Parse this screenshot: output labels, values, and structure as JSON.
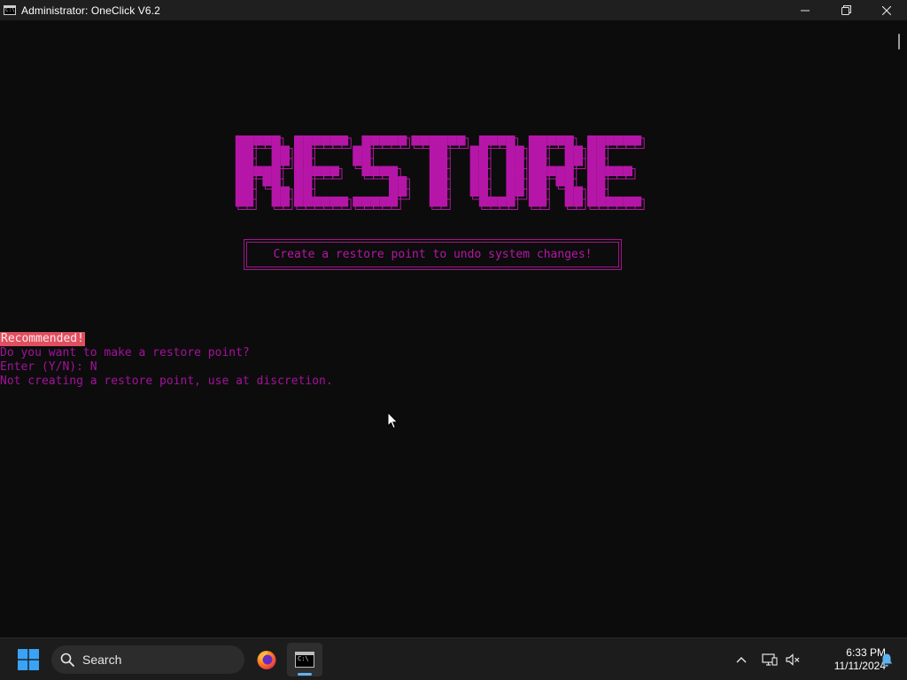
{
  "window": {
    "title": "Administrator:  OneClick V6.2",
    "icon": "console-icon",
    "icon_glyph": "C:\\"
  },
  "terminal": {
    "banner_text": "RESTORE",
    "subtitle": "Create a restore point to undo system changes!",
    "lines": {
      "recommended": "Recommended!",
      "question": "Do you want to make a restore point?",
      "prompt": "Enter (Y/N): N",
      "result": "Not creating a restore point, use at discretion."
    },
    "colors": {
      "magenta": "#b616a8",
      "text": "#a3129a",
      "badge_bg": "#e04f5f",
      "background": "#0c0c0c"
    }
  },
  "taskbar": {
    "search_label": "Search",
    "apps": [
      "firefox-icon",
      "terminal-icon"
    ],
    "clock": {
      "time": "6:33 PM",
      "date": "11/11/2024"
    }
  }
}
